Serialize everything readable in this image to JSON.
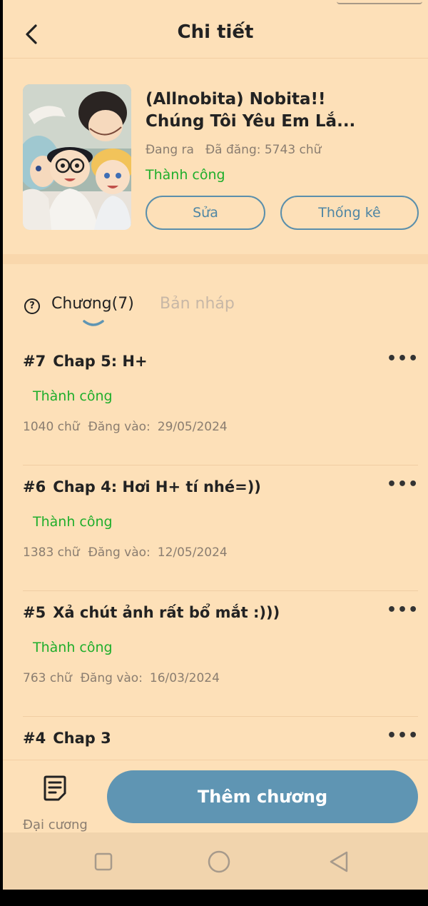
{
  "header": {
    "title": "Chi tiết"
  },
  "book": {
    "title_line1": "(Allnobita) Nobita!!",
    "title_line2": "Chúng Tôi Yêu Em Lắ...",
    "state": "Đang ra",
    "word_count": "Đã đăng: 5743 chữ",
    "status": "Thành công",
    "edit_label": "Sửa",
    "stats_label": "Thống kê"
  },
  "tabs": {
    "help_symbol": "?",
    "chapters_label": "Chương(7)",
    "drafts_label": "Bản nháp"
  },
  "chapters": [
    {
      "num": "#7",
      "title": "Chap 5: H+",
      "status": "Thành công",
      "words": "1040 chữ",
      "posted_label": "Đăng vào:",
      "date": "29/05/2024"
    },
    {
      "num": "#6",
      "title": "Chap 4: Hơi H+ tí nhé=))",
      "status": "Thành công",
      "words": "1383 chữ",
      "posted_label": "Đăng vào:",
      "date": "12/05/2024"
    },
    {
      "num": "#5",
      "title": "Xả chút ảnh rất bổ mắt :)))",
      "status": "Thành công",
      "words": "763 chữ",
      "posted_label": "Đăng vào:",
      "date": "16/03/2024"
    },
    {
      "num": "#4",
      "title": "Chap 3"
    }
  ],
  "more_symbol": "•••",
  "bottom": {
    "outline_label": "Đại cương",
    "add_chapter_label": "Thêm chương"
  },
  "colors": {
    "background": "#fde0b8",
    "accent": "#5f95b3",
    "success": "#1fae2b",
    "muted": "#8a7d70"
  },
  "icons": {
    "back": "chevron-left-icon",
    "help": "question-circle-icon",
    "more": "more-horizontal-icon",
    "outline": "document-list-icon",
    "nav_recent": "square-icon",
    "nav_home": "circle-icon",
    "nav_back": "triangle-back-icon"
  }
}
